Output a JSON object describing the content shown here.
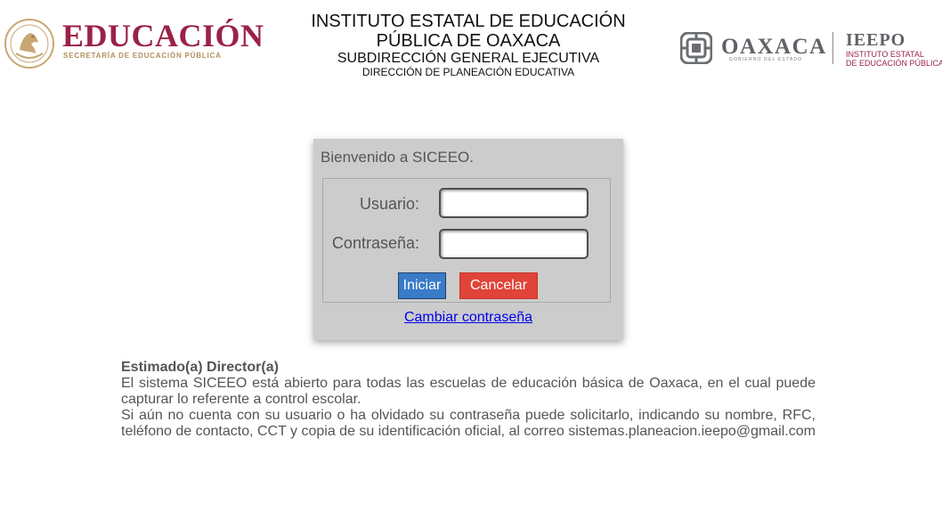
{
  "header": {
    "left_logo": {
      "name": "EDUCACIÓN",
      "subtitle": "SECRETARÍA DE EDUCACIÓN PÚBLICA",
      "brand_color": "#9b2247",
      "accent_color": "#b38e5d"
    },
    "title_line1": "INSTITUTO ESTATAL DE EDUCACIÓN",
    "title_line2": "PÚBLICA DE OAXACA",
    "subtitle1": "SUBDIRECCIÓN GENERAL EJECUTIVA",
    "subtitle2": "DIRECCIÓN DE PLANEACIÓN EDUCATIVA",
    "right_logo": {
      "oaxaca": "OAXACA",
      "oaxaca_small": "GOBIERNO DEL ESTADO",
      "ieepo": "IEEPO",
      "ieepo_sub1": "INSTITUTO ESTATAL",
      "ieepo_sub2": "DE EDUCACIÓN PÚBLICA"
    }
  },
  "login": {
    "welcome": "Bienvenido a SICEEO.",
    "user_label": "Usuario:",
    "user_value": "",
    "password_label": "Contraseña:",
    "password_value": "",
    "submit_label": "Iniciar",
    "cancel_label": "Cancelar",
    "change_password_link": "Cambiar contraseña",
    "submit_color": "#3a7bc8",
    "cancel_color": "#e04337",
    "panel_color": "#cccccc"
  },
  "info": {
    "title": "Estimado(a) Director(a)",
    "paragraph1": "El sistema SICEEO está abierto para todas las escuelas de educación básica de Oaxaca, en el cual puede capturar lo referente a control escolar.",
    "paragraph2": "Si aún no cuenta con su usuario o ha olvidado su contraseña puede solicitarlo, indicando su nombre, RFC, teléfono de contacto, CCT y copia de su identificación oficial, al correo sistemas.planeacion.ieepo@gmail.com"
  }
}
